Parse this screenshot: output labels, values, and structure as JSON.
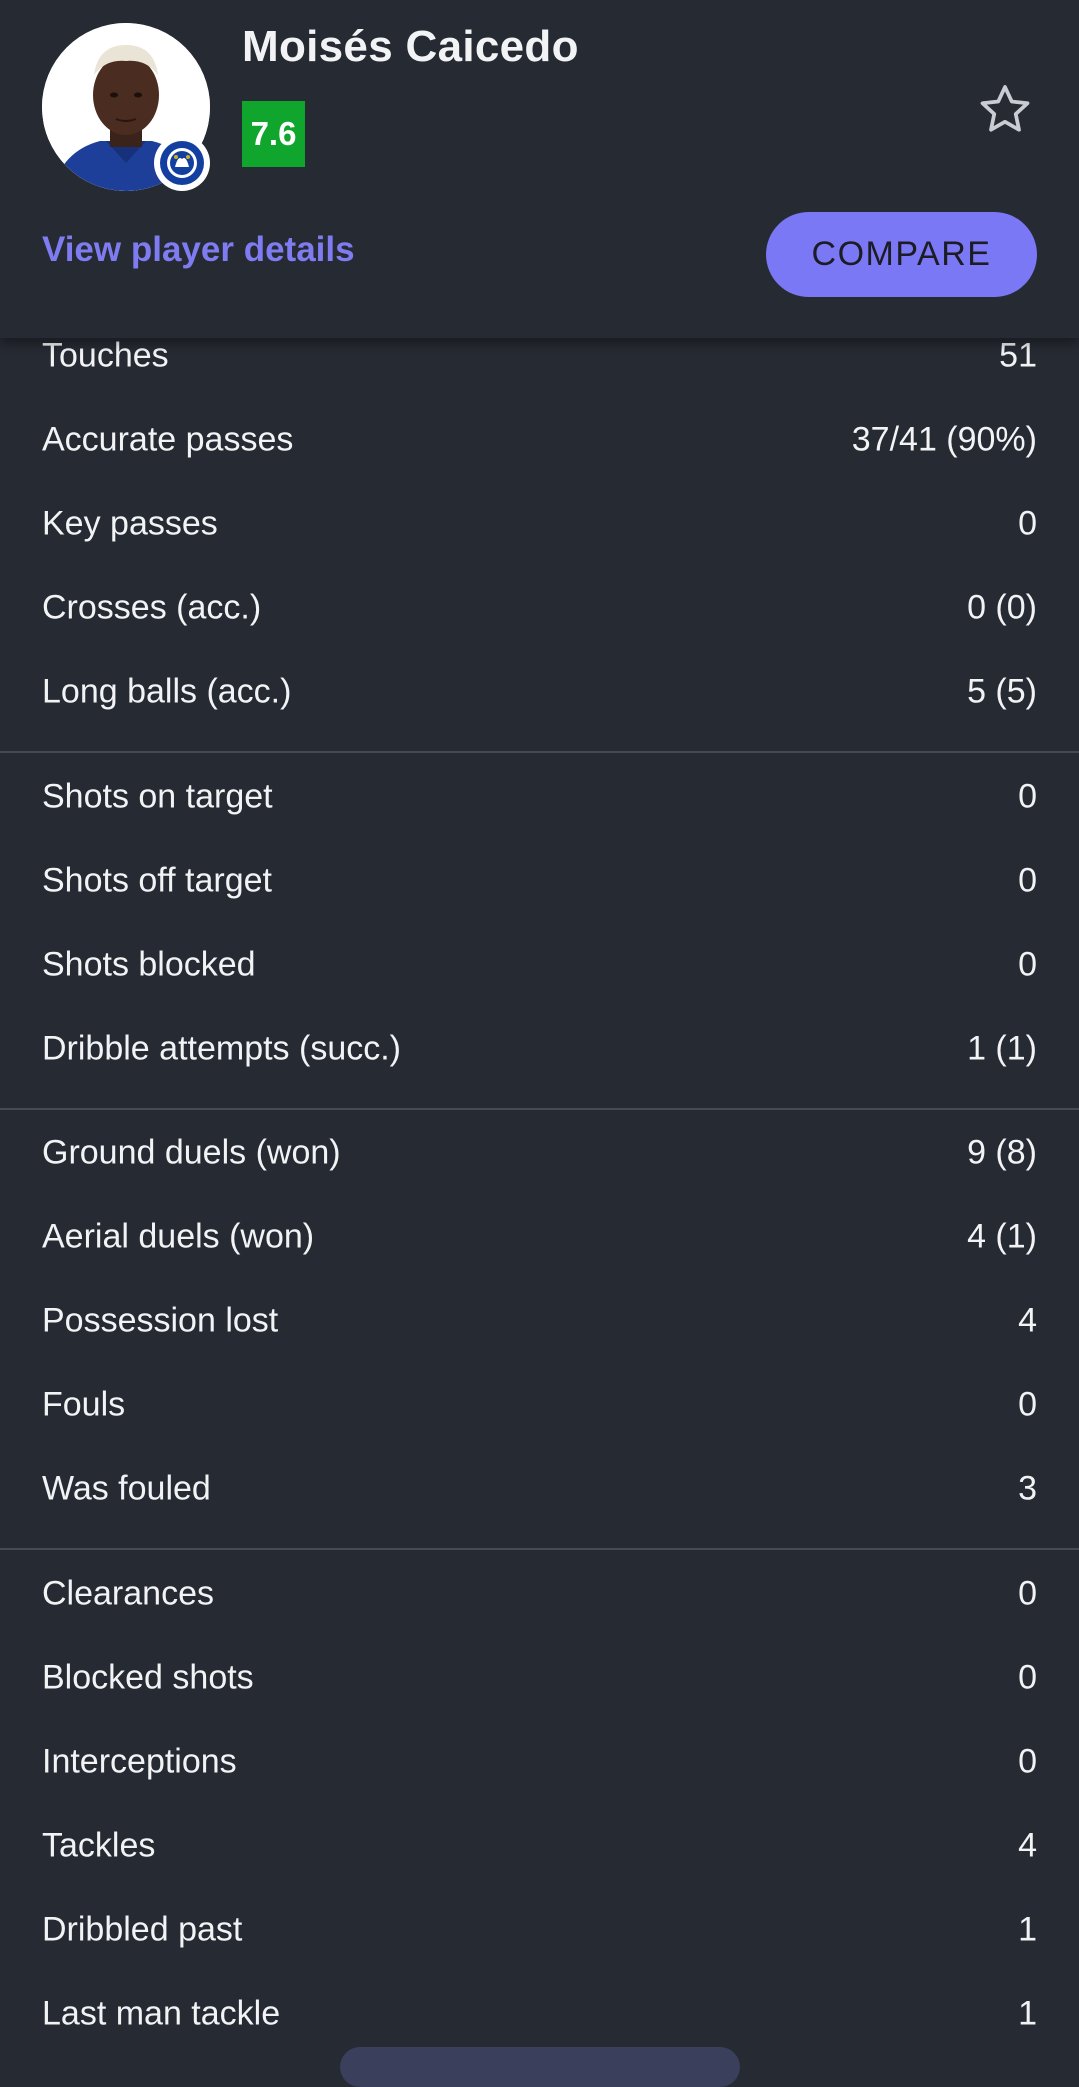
{
  "player": {
    "name": "Moisés Caicedo",
    "rating": "7.6",
    "rating_color": "#10a52c",
    "avatar_icon": "player-photo",
    "club_badge_icon": "chelsea-crest-icon"
  },
  "actions": {
    "view_details_label": "View player details",
    "compare_label": "COMPARE",
    "favorite_icon": "star-outline-icon"
  },
  "colors": {
    "accent": "#7b78f6",
    "link": "#7f7cf2",
    "background": "#262a33"
  },
  "stat_groups": [
    [
      {
        "label": "Touches",
        "value": "51"
      },
      {
        "label": "Accurate passes",
        "value": "37/41 (90%)"
      },
      {
        "label": "Key passes",
        "value": "0"
      },
      {
        "label": "Crosses (acc.)",
        "value": "0 (0)"
      },
      {
        "label": "Long balls (acc.)",
        "value": "5 (5)"
      }
    ],
    [
      {
        "label": "Shots on target",
        "value": "0"
      },
      {
        "label": "Shots off target",
        "value": "0"
      },
      {
        "label": "Shots blocked",
        "value": "0"
      },
      {
        "label": "Dribble attempts (succ.)",
        "value": "1 (1)"
      }
    ],
    [
      {
        "label": "Ground duels (won)",
        "value": "9 (8)"
      },
      {
        "label": "Aerial duels (won)",
        "value": "4 (1)"
      },
      {
        "label": "Possession lost",
        "value": "4"
      },
      {
        "label": "Fouls",
        "value": "0"
      },
      {
        "label": "Was fouled",
        "value": "3"
      }
    ],
    [
      {
        "label": "Clearances",
        "value": "0"
      },
      {
        "label": "Blocked shots",
        "value": "0"
      },
      {
        "label": "Interceptions",
        "value": "0"
      },
      {
        "label": "Tackles",
        "value": "4"
      },
      {
        "label": "Dribbled past",
        "value": "1"
      },
      {
        "label": "Last man tackle",
        "value": "1"
      }
    ]
  ]
}
